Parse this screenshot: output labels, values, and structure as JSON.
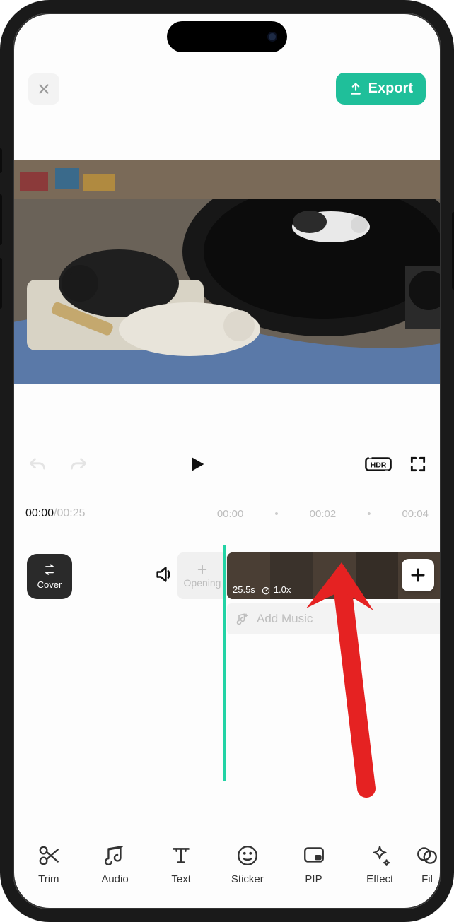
{
  "header": {
    "export_label": "Export"
  },
  "time": {
    "current": "00:00",
    "total": "00:25",
    "marks": [
      "00:00",
      "00:02",
      "00:04"
    ]
  },
  "cover_label": "Cover",
  "opening_label": "Opening",
  "clip": {
    "duration": "25.5s",
    "speed": "1.0x"
  },
  "music": {
    "add_label": "Add Music"
  },
  "toolbar": {
    "trim": "Trim",
    "audio": "Audio",
    "text": "Text",
    "sticker": "Sticker",
    "pip": "PIP",
    "effect": "Effect",
    "filter": "Fil"
  },
  "colors": {
    "accent": "#1fbf9a"
  }
}
